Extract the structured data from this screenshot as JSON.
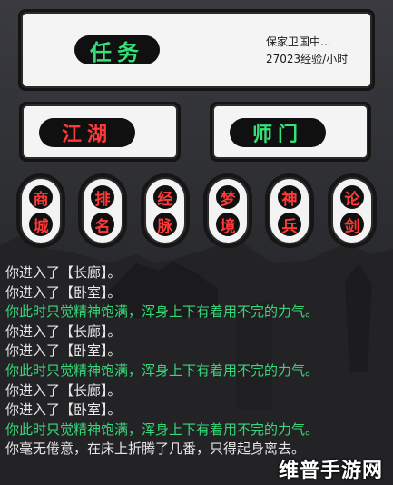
{
  "quest": {
    "button_label": "任务",
    "status_line": "保家卫国中...",
    "exp_rate": "27023经验/小时"
  },
  "jianghu": {
    "label": "江湖"
  },
  "shimen": {
    "label": "师门"
  },
  "menu": [
    {
      "chars": [
        "商",
        "城"
      ]
    },
    {
      "chars": [
        "排",
        "名"
      ]
    },
    {
      "chars": [
        "经",
        "脉"
      ]
    },
    {
      "chars": [
        "梦",
        "境"
      ]
    },
    {
      "chars": [
        "神",
        "兵"
      ]
    },
    {
      "chars": [
        "论",
        "剑"
      ]
    }
  ],
  "log": [
    {
      "text": "你进入了【长廊】。",
      "tone": "white"
    },
    {
      "text": "你进入了【卧室】。",
      "tone": "white"
    },
    {
      "text": "你此时只觉精神饱满，浑身上下有着用不完的力气。",
      "tone": "green"
    },
    {
      "text": "你进入了【长廊】。",
      "tone": "white"
    },
    {
      "text": "你进入了【卧室】。",
      "tone": "white"
    },
    {
      "text": "你此时只觉精神饱满，浑身上下有着用不完的力气。",
      "tone": "green"
    },
    {
      "text": "你进入了【长廊】。",
      "tone": "white"
    },
    {
      "text": "你进入了【卧室】。",
      "tone": "white"
    },
    {
      "text": "你此时只觉精神饱满，浑身上下有着用不完的力气。",
      "tone": "green"
    },
    {
      "text": "你毫无倦意，在床上折腾了几番，只得起身离去。",
      "tone": "white"
    }
  ],
  "watermark": "维普手游网",
  "colors": {
    "green_text": "#36e07a",
    "red_text": "#ff3838",
    "log_green": "#36d97a"
  }
}
